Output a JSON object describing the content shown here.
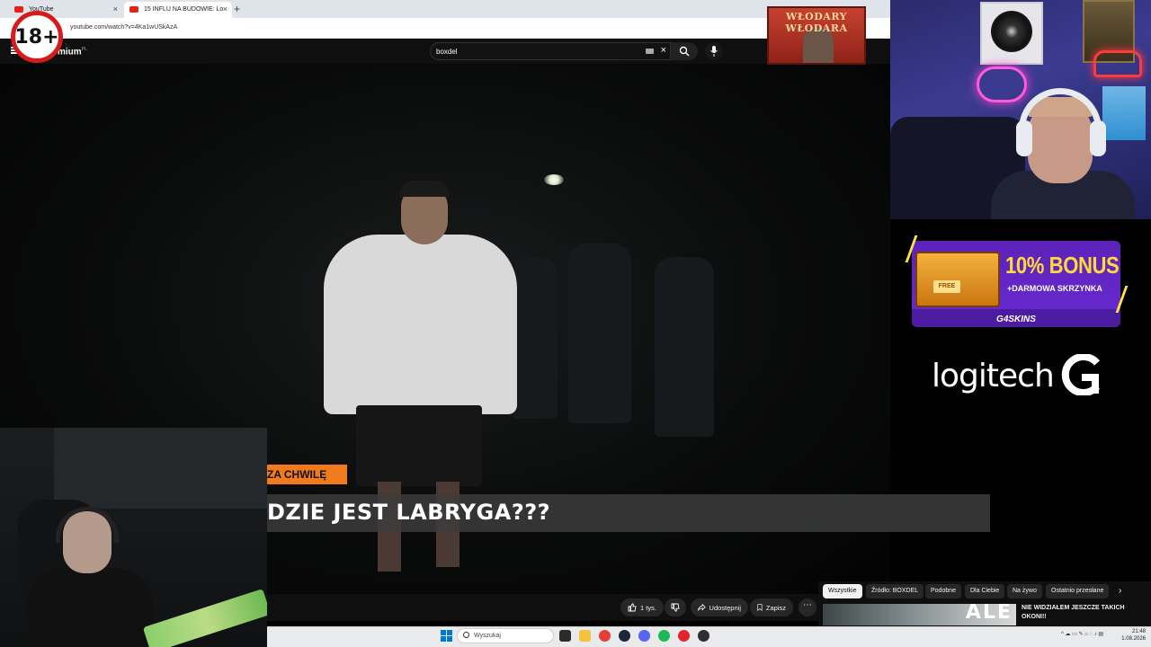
{
  "browser": {
    "tabs": [
      {
        "label": "YouTube",
        "close": "×"
      },
      {
        "label": "15 INFLU NA BUDOWIE: Lo",
        "close": "×"
      }
    ],
    "new_tab": "+",
    "url": "youtube.com/watch?v=4Ka1wUSkAzA"
  },
  "overlay": {
    "age_badge": "18+"
  },
  "youtube": {
    "logo_text": "mium",
    "logo_sup": "PL",
    "search": {
      "value": "boxdel",
      "clear": "×"
    },
    "icons": [
      "menu-icon",
      "search-icon",
      "mic-icon",
      "keyboard-icon"
    ]
  },
  "poster": {
    "line1": "WŁODARY",
    "line2": "WŁODARA"
  },
  "video": {
    "tag": "ZA CHWILĘ",
    "caption": "DZIE JEST LABRYGA???"
  },
  "actions": {
    "like_count": "1 tys.",
    "share": "Udostępnij",
    "save": "Zapisz",
    "more": "⋯"
  },
  "recommend": {
    "chips": [
      {
        "label": "Wszystkie",
        "active": true
      },
      {
        "label": "Źródło: BOXDEL",
        "active": false
      },
      {
        "label": "Podobne",
        "active": false
      },
      {
        "label": "Dla Ciebie",
        "active": false
      },
      {
        "label": "Na żywo",
        "active": false
      },
      {
        "label": "Ostatnio przesłane",
        "active": false
      }
    ],
    "next": "›",
    "first_title": "NIE WIDZIAŁEM JESZCZE TAKICH OKONI!!",
    "first_thumb_text": "ALE"
  },
  "taskbar": {
    "search_placeholder": "Wyszukaj",
    "time": "21:48",
    "date": "1.08.2026",
    "icons": [
      {
        "name": "task-view-icon",
        "color": "#2b2b2b"
      },
      {
        "name": "file-explorer-icon",
        "color": "#f3c33c"
      },
      {
        "name": "chrome-icon",
        "color": "#e44134"
      },
      {
        "name": "steam-icon",
        "color": "#1b2838"
      },
      {
        "name": "discord-icon",
        "color": "#5865f2"
      },
      {
        "name": "spotify-icon",
        "color": "#1db954"
      },
      {
        "name": "app-red-icon",
        "color": "#e0262c"
      },
      {
        "name": "obs-icon",
        "color": "#302e31"
      }
    ]
  },
  "sponsor": {
    "bonus": "10% BONUS",
    "sub": "+DARMOWA SKRZYNKA",
    "free_label": "FREE",
    "brand": "G4SKINS",
    "logitech": "logitech"
  }
}
